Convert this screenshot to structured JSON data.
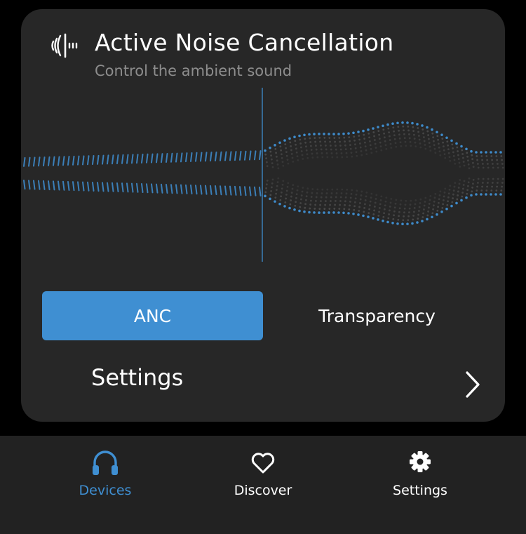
{
  "colors": {
    "accent": "#3f8fd2",
    "card_background": "#272727",
    "page_background": "#000000",
    "tabbar_background": "#222222",
    "text_primary": "#ffffff",
    "text_secondary": "#8d8d8d"
  },
  "anc_card": {
    "icon": "anc-icon",
    "title": "Active Noise Cancellation",
    "subtitle": "Control the ambient sound",
    "modes": [
      {
        "label": "ANC",
        "selected": true
      },
      {
        "label": "Transparency",
        "selected": false
      }
    ],
    "settings_label": "Settings",
    "settings_icon": "chevron-right-icon"
  },
  "tabbar": {
    "tabs": [
      {
        "label": "Devices",
        "icon": "headphones-icon",
        "active": true
      },
      {
        "label": "Discover",
        "icon": "heart-icon",
        "active": false
      },
      {
        "label": "Settings",
        "icon": "gear-icon",
        "active": false
      }
    ]
  }
}
